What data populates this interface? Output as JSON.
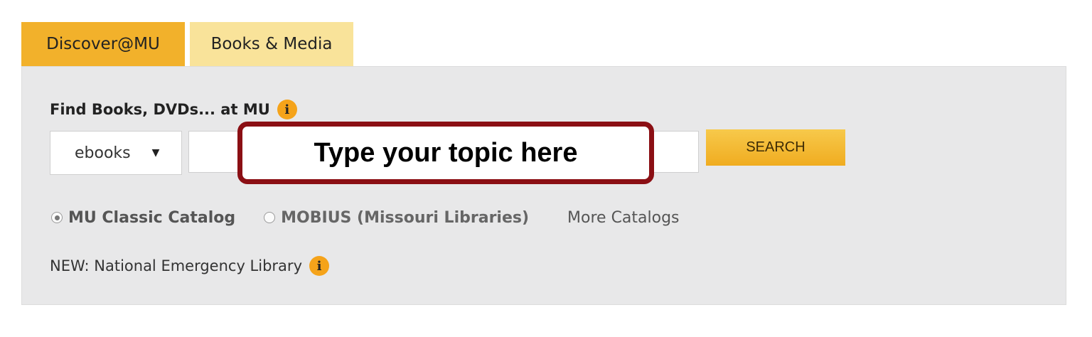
{
  "tabs": {
    "active": "Discover@MU",
    "inactive": "Books & Media"
  },
  "search": {
    "heading": "Find Books, DVDs... at MU",
    "info_icon": "i",
    "format": "ebooks",
    "input_value": "",
    "button_label": "SEARCH"
  },
  "callout": {
    "text": "Type your topic here"
  },
  "catalogs": {
    "mu_classic": "MU Classic Catalog",
    "mobius": "MOBIUS (Missouri Libraries)",
    "more": "More Catalogs"
  },
  "notice": {
    "text": "NEW: National Emergency Library",
    "info_icon": "i"
  },
  "colors": {
    "tab_active": "#f2b12b",
    "tab_inactive": "#f9e39a",
    "panel_bg": "#e8e8e9",
    "callout_border": "#8b0f14",
    "button": "#f0ac20"
  }
}
